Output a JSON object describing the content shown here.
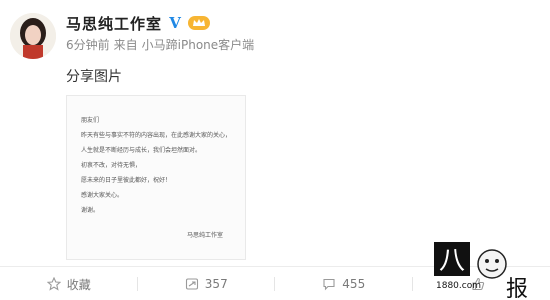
{
  "author": {
    "name": "马思纯工作室",
    "verified_mark": "V"
  },
  "meta": {
    "time": "6分钟前",
    "source_prefix": "来自",
    "client": "小马蹄iPhone客户端"
  },
  "post": {
    "text": "分享图片"
  },
  "image_letter": {
    "greeting": "朋友们",
    "paragraphs": [
      "昨天有些与事实不符的内容出现，在此感谢大家的关心，",
      "人生就是不断经历与成长，我们会坦然面对。",
      "初衷不改，对待无惧，",
      "愿未来的日子里彼此都好，祝好！",
      "感谢大家关心。",
      "谢谢。"
    ],
    "signature": "马思纯工作室"
  },
  "actions": {
    "favorite_label": "收藏",
    "repost_count": "357",
    "comment_count": "455",
    "like_label": ""
  },
  "watermark": {
    "text": "八卦报",
    "site": "1880.com"
  },
  "colors": {
    "accent_blue": "#1f88e5",
    "vip_gold": "#f7b533",
    "muted_text": "#8a8a8a"
  }
}
